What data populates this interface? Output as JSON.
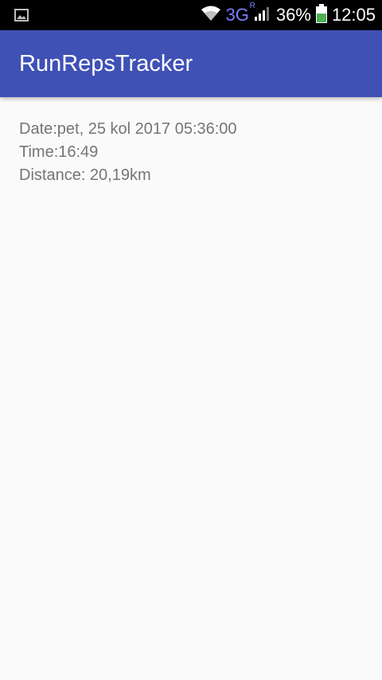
{
  "status_bar": {
    "left_icon": "image-icon",
    "wifi_icon": "wifi-icon",
    "network_type": "3G",
    "roaming_indicator": "R",
    "signal_icon": "signal-bars-icon",
    "battery_percent": "36%",
    "battery_icon": "battery-icon",
    "time": "12:05",
    "colors": {
      "background": "#000000",
      "network": "#7b7cff",
      "battery_fill": "#4caf50"
    }
  },
  "app_bar": {
    "title": "RunRepsTracker",
    "color": "#3f51b5"
  },
  "run_details": {
    "date": "Date:pet, 25 kol 2017 05:36:00",
    "time": "Time:16:49",
    "distance": "Distance: 20,19km"
  }
}
